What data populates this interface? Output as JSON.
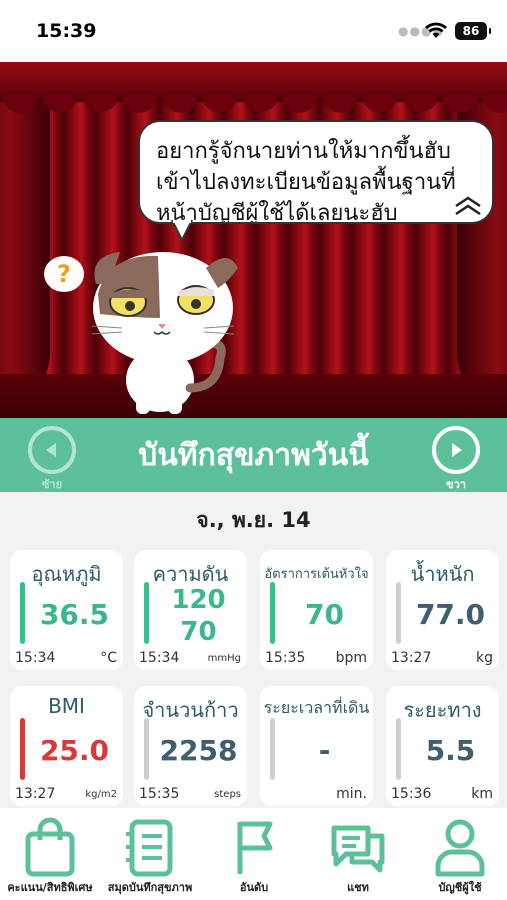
{
  "status_bar": {
    "time": "15:39",
    "battery": "86"
  },
  "speech": {
    "text": "อยากรู้จักนายท่านให้มากขึ้นฮับ เข้าไปลงทะเบียนข้อมูลพื้นฐานที่ หน้าบัญชีผู้ใช้ได้เลยนะฮับ",
    "question_mark": "?"
  },
  "header": {
    "title": "บันทึกสุขภาพวันนี้",
    "left_label": "ซ้าย",
    "right_label": "ขวา"
  },
  "date": "จ., พ.ย. 14",
  "cards": [
    {
      "title": "อุณหภูมิ",
      "value": "36.5",
      "time": "15:34",
      "unit": "°C"
    },
    {
      "title": "ความดัน",
      "value_top": "120",
      "value_bottom": "70",
      "time": "15:34",
      "unit": "mmHg"
    },
    {
      "title": "อัตราการเต้นหัวใจ",
      "value": "70",
      "time": "15:35",
      "unit": "bpm"
    },
    {
      "title": "น้ำหนัก",
      "value": "77.0",
      "time": "13:27",
      "unit": "kg"
    },
    {
      "title": "BMI",
      "value": "25.0",
      "time": "13:27",
      "unit": "kg/m2"
    },
    {
      "title": "จำนวนก้าว",
      "value": "2258",
      "time": "15:35",
      "unit": "steps"
    },
    {
      "title": "ระยะเวลาที่เดิน",
      "value": "-",
      "time": "",
      "unit": "min."
    },
    {
      "title": "ระยะทาง",
      "value": "5.5",
      "time": "15:36",
      "unit": "km"
    }
  ],
  "tabs": [
    {
      "label": "คะแนน/สิทธิพิเศษ",
      "icon": "shopping-bag-icon"
    },
    {
      "label": "สมุดบันทึกสุขภาพ",
      "icon": "notebook-icon"
    },
    {
      "label": "อันดับ",
      "icon": "flag-icon"
    },
    {
      "label": "แชท",
      "icon": "chat-icon"
    },
    {
      "label": "บัญชีผู้ใช้",
      "icon": "user-icon"
    }
  ],
  "colors": {
    "accent": "#5cc199",
    "green_bar": "#2ec58a",
    "red": "#d83a3a",
    "gray_bar": "#cfcfcf"
  }
}
